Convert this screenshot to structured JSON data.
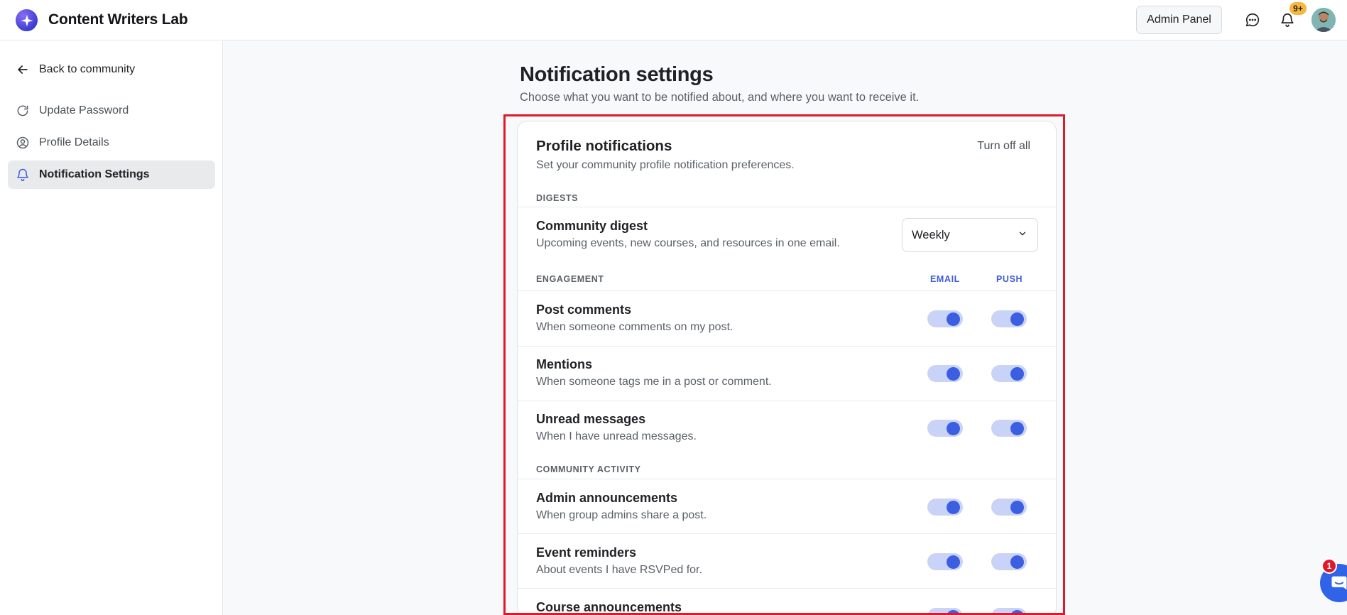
{
  "app": {
    "brand": "Content Writers Lab",
    "admin_panel_label": "Admin Panel",
    "notifications_badge": "9+",
    "chat_badge": "1",
    "colors": {
      "accent": "#3c5ee0",
      "toggle_track": "#c9d3f7",
      "highlight": "#e0182a",
      "badge": "#f6b73c"
    }
  },
  "sidebar": {
    "back_label": "Back to community",
    "items": [
      {
        "label": "Update Password",
        "icon": "refresh-icon"
      },
      {
        "label": "Profile Details",
        "icon": "user-circle-icon"
      },
      {
        "label": "Notification Settings",
        "icon": "bell-icon",
        "active": true
      }
    ]
  },
  "page": {
    "title": "Notification settings",
    "subtitle": "Choose what you want to be notified about, and where you want to receive it."
  },
  "card": {
    "title": "Profile notifications",
    "subtitle": "Set your community profile notification preferences.",
    "turn_off_all": "Turn off all",
    "digests": {
      "label": "DIGESTS",
      "item": {
        "title": "Community digest",
        "desc": "Upcoming events, new courses, and resources in one email.",
        "frequency": "Weekly"
      }
    },
    "engagement": {
      "label": "ENGAGEMENT",
      "col_email": "EMAIL",
      "col_push": "PUSH",
      "items": [
        {
          "title": "Post comments",
          "desc": "When someone comments on my post.",
          "email": true,
          "push": true
        },
        {
          "title": "Mentions",
          "desc": "When someone tags me in a post or comment.",
          "email": true,
          "push": true
        },
        {
          "title": "Unread messages",
          "desc": "When I have unread messages.",
          "email": true,
          "push": true
        }
      ]
    },
    "community_activity": {
      "label": "COMMUNITY ACTIVITY",
      "items": [
        {
          "title": "Admin announcements",
          "desc": "When group admins share a post.",
          "email": true,
          "push": true
        },
        {
          "title": "Event reminders",
          "desc": "About events I have RSVPed for.",
          "email": true,
          "push": true
        },
        {
          "title": "Course announcements",
          "desc": "",
          "email": true,
          "push": true
        }
      ]
    }
  }
}
